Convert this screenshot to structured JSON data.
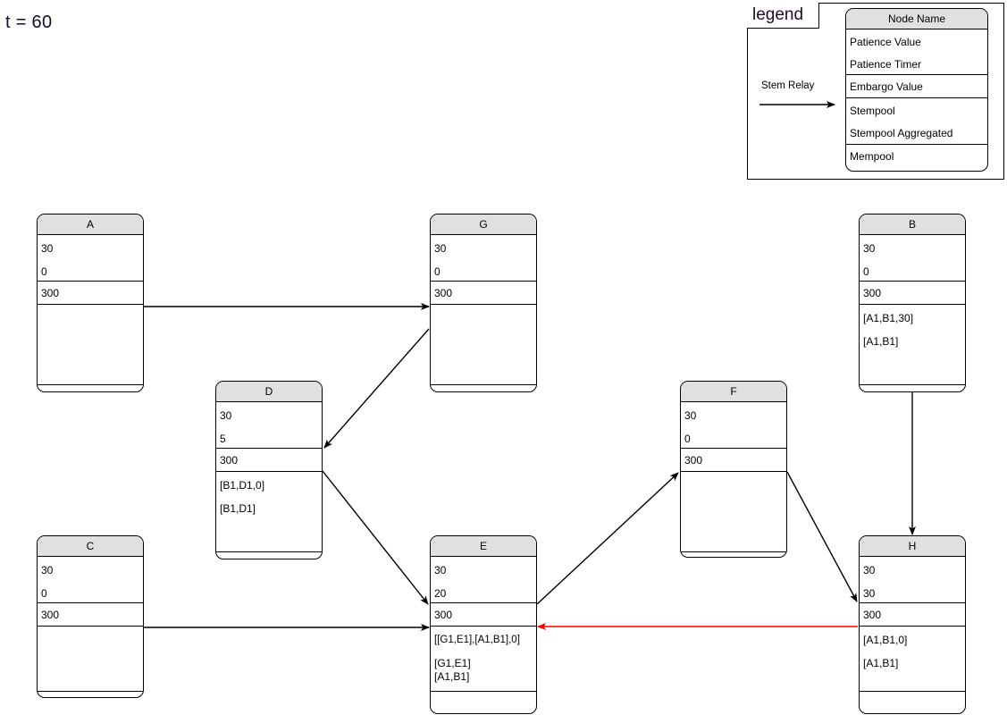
{
  "title": "t = 60",
  "colors": {
    "node_header_fill": "#e0e0e0",
    "stroke": "#000000",
    "relay_arrow": "#000000",
    "red_arrow": "#ff0000",
    "title_text": "#13102b"
  },
  "legend": {
    "title": "legend",
    "relay_label": "Stem Relay",
    "template_node": {
      "name": "Node Name",
      "patience_value": "Patience Value",
      "patience_timer": "Patience Timer",
      "embargo_value": "Embargo Value",
      "stempool": "Stempool",
      "stempool_aggregated": "Stempool Aggregated",
      "mempool": "Mempool"
    }
  },
  "nodes": [
    {
      "id": "A",
      "name": "A",
      "patience_value": "30",
      "patience_timer": "0",
      "embargo_value": "300",
      "stempool": "",
      "stempool_aggregated": "",
      "mempool": ""
    },
    {
      "id": "G",
      "name": "G",
      "patience_value": "30",
      "patience_timer": "0",
      "embargo_value": "300",
      "stempool": "",
      "stempool_aggregated": "",
      "mempool": ""
    },
    {
      "id": "B",
      "name": "B",
      "patience_value": "30",
      "patience_timer": "0",
      "embargo_value": "300",
      "stempool": "[A1,B1,30]",
      "stempool_aggregated": "[A1,B1]",
      "mempool": ""
    },
    {
      "id": "D",
      "name": "D",
      "patience_value": "30",
      "patience_timer": "5",
      "embargo_value": "300",
      "stempool": "[B1,D1,0]",
      "stempool_aggregated": "[B1,D1]",
      "mempool": ""
    },
    {
      "id": "F",
      "name": "F",
      "patience_value": "30",
      "patience_timer": "0",
      "embargo_value": "300",
      "stempool": "",
      "stempool_aggregated": "",
      "mempool": ""
    },
    {
      "id": "C",
      "name": "C",
      "patience_value": "30",
      "patience_timer": "0",
      "embargo_value": "300",
      "stempool": "",
      "stempool_aggregated": "",
      "mempool": ""
    },
    {
      "id": "E",
      "name": "E",
      "patience_value": "30",
      "patience_timer": "20",
      "embargo_value": "300",
      "stempool": "[[G1,E1],[A1,B1],0]",
      "stempool_aggregated_line1": "[G1,E1]",
      "stempool_aggregated_line2": "[A1,B1]",
      "mempool": ""
    },
    {
      "id": "H",
      "name": "H",
      "patience_value": "30",
      "patience_timer": "30",
      "embargo_value": "300",
      "stempool": "[A1,B1,0]",
      "stempool_aggregated": "[A1,B1]",
      "mempool": ""
    }
  ],
  "edges": [
    {
      "from": "A",
      "to": "G",
      "color": "#000000"
    },
    {
      "from": "G",
      "to": "D",
      "color": "#000000"
    },
    {
      "from": "D",
      "to": "E",
      "color": "#000000"
    },
    {
      "from": "C",
      "to": "E",
      "color": "#000000"
    },
    {
      "from": "E",
      "to": "F",
      "color": "#000000"
    },
    {
      "from": "B",
      "to": "H",
      "color": "#000000"
    },
    {
      "from": "F",
      "to": "H",
      "color": "#000000"
    },
    {
      "from": "H",
      "to": "E",
      "color": "#ff0000"
    }
  ]
}
